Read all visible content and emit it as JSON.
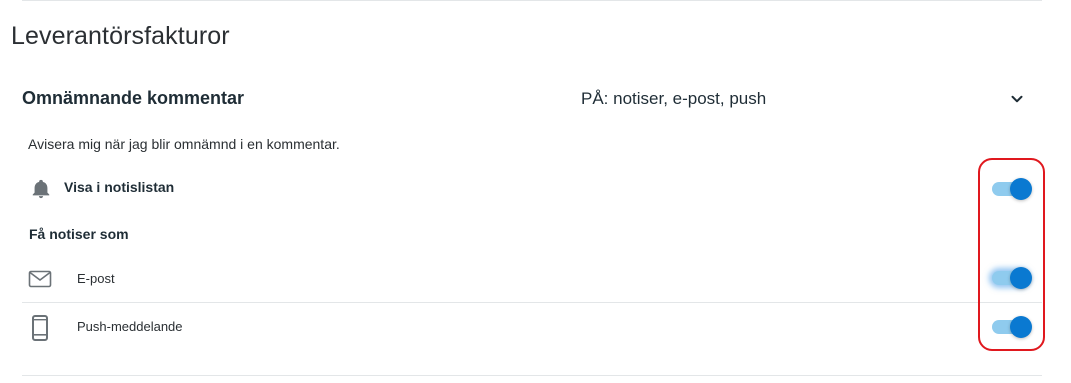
{
  "section": {
    "title": "Leverantörsfakturor"
  },
  "setting": {
    "name": "Omnämnande kommentar",
    "summary": "PÅ: notiser, e-post, push",
    "expand_icon": "chevron-down-icon",
    "description": "Avisera mig när jag blir omnämnd i en kommentar."
  },
  "notislist": {
    "icon": "bell-icon",
    "label": "Visa i notislistan",
    "enabled": true
  },
  "channels": {
    "heading": "Få notiser som",
    "email": {
      "icon": "mail-icon",
      "label": "E-post",
      "enabled": true
    },
    "push": {
      "icon": "phone-icon",
      "label": "Push-meddelande",
      "enabled": true
    }
  },
  "colors": {
    "toggle_thumb": "#0a79d1",
    "toggle_track": "#8fcbee",
    "highlight": "#e0181e",
    "icon": "#6b7277"
  }
}
